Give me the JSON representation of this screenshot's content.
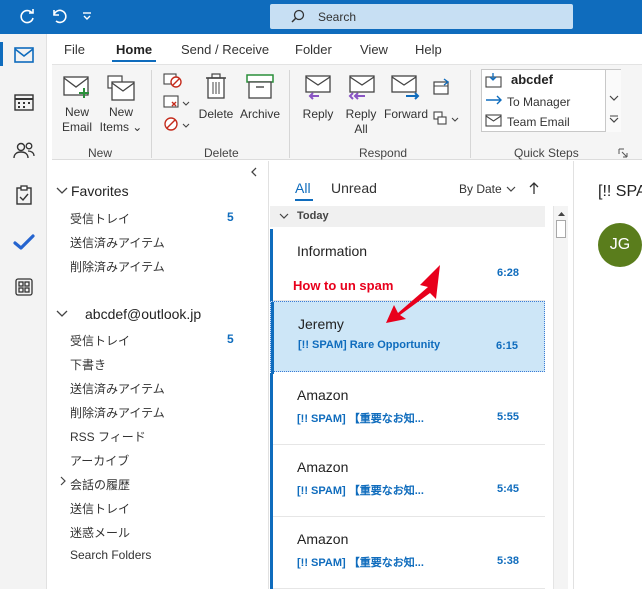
{
  "titlebar": {
    "search_placeholder": "Search",
    "icons": [
      "sync-icon",
      "undo-icon",
      "customize-icon"
    ]
  },
  "rail": {
    "icons": [
      "mail-icon",
      "calendar-icon",
      "people-icon",
      "tasks-icon",
      "todo-icon",
      "apps-icon"
    ]
  },
  "menu": [
    "File",
    "Home",
    "Send / Receive",
    "Folder",
    "View",
    "Help"
  ],
  "ribbon": {
    "new": {
      "new_email": [
        "New",
        "Email"
      ],
      "new_items": [
        "New",
        "Items ⌄"
      ],
      "group": "New"
    },
    "delete": {
      "delete": "Delete",
      "archive": "Archive",
      "group": "Delete"
    },
    "respond": {
      "reply": "Reply",
      "reply_all": [
        "Reply",
        "All"
      ],
      "forward": "Forward",
      "group": "Respond"
    },
    "quick_steps": {
      "items": [
        "abcdef",
        "To Manager",
        "Team Email"
      ],
      "group": "Quick Steps"
    }
  },
  "folders": {
    "favorites_header": "Favorites",
    "favorites": [
      {
        "label": "受信トレイ",
        "count": "5"
      },
      {
        "label": "送信済みアイテム",
        "count": ""
      },
      {
        "label": "削除済みアイテム",
        "count": ""
      }
    ],
    "account_header": "abcdef@outlook.jp",
    "account": [
      {
        "label": "受信トレイ",
        "count": "5"
      },
      {
        "label": "下書き",
        "count": ""
      },
      {
        "label": "送信済みアイテム",
        "count": ""
      },
      {
        "label": "削除済みアイテム",
        "count": ""
      },
      {
        "label": "RSS フィード",
        "count": ""
      },
      {
        "label": "アーカイブ",
        "count": ""
      },
      {
        "label": "会話の履歴",
        "count": ""
      },
      {
        "label": "送信トレイ",
        "count": ""
      },
      {
        "label": "迷惑メール",
        "count": ""
      },
      {
        "label": "Search Folders",
        "count": ""
      }
    ]
  },
  "list": {
    "tab_all": "All",
    "tab_unread": "Unread",
    "sort": "By Date",
    "group_today": "Today",
    "messages": [
      {
        "sender": "Information",
        "subject": "",
        "time": "6:28"
      },
      {
        "sender": "Jeremy",
        "subject": "[!! SPAM]  Rare Opportunity",
        "time": "6:15"
      },
      {
        "sender": "Amazon",
        "subject": "[!! SPAM]  【重要なお知...",
        "time": "5:55"
      },
      {
        "sender": "Amazon",
        "subject": "[!! SPAM]  【重要なお知...",
        "time": "5:45"
      },
      {
        "sender": "Amazon",
        "subject": "[!! SPAM]  【重要なお知...",
        "time": "5:38"
      }
    ]
  },
  "annotation": {
    "text": "How to un spam",
    "color": "#e8001c"
  },
  "reading": {
    "subject": "[!! SPA",
    "avatar_initials": "JG"
  },
  "colors": {
    "accent": "#0f6cbd",
    "selected": "#cde6f7",
    "avatar": "#5a7d1c"
  }
}
